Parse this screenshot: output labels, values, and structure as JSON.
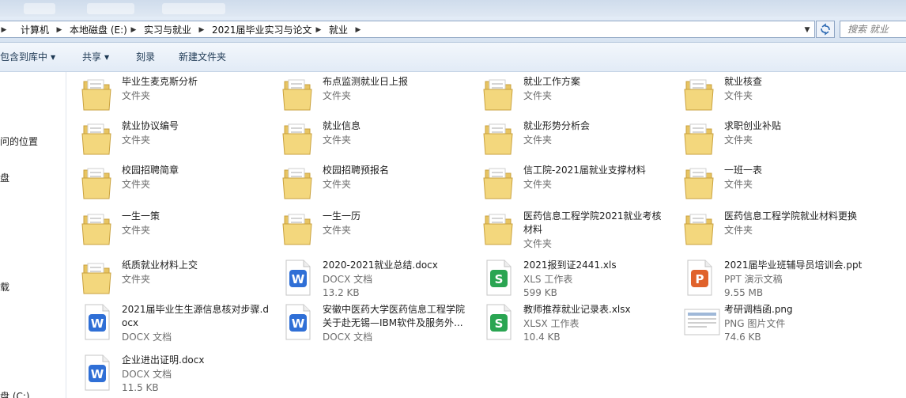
{
  "address": {
    "breadcrumbs": [
      "计算机",
      "本地磁盘 (E:)",
      "实习与就业",
      "2021届毕业实习与论文",
      "就业"
    ]
  },
  "search": {
    "placeholder": "搜索 就业"
  },
  "toolbar": {
    "include_label": "包含到库中",
    "share_label": "共享",
    "burn_label": "刻录",
    "new_folder_label": "新建文件夹"
  },
  "nav": {
    "items": [
      "问的位置",
      "盘",
      "载",
      "盘 (C:)"
    ]
  },
  "files": [
    {
      "name": "毕业生麦克斯分析",
      "type": "文件夹",
      "size": "",
      "icon": "folder-icon"
    },
    {
      "name": "布点监测就业日上报",
      "type": "文件夹",
      "size": "",
      "icon": "folder-icon"
    },
    {
      "name": "就业工作方案",
      "type": "文件夹",
      "size": "",
      "icon": "folder-icon"
    },
    {
      "name": "就业核查",
      "type": "文件夹",
      "size": "",
      "icon": "folder-icon"
    },
    {
      "name": "就业协议编号",
      "type": "文件夹",
      "size": "",
      "icon": "folder-icon"
    },
    {
      "name": "就业信息",
      "type": "文件夹",
      "size": "",
      "icon": "folder-icon"
    },
    {
      "name": "就业形势分析会",
      "type": "文件夹",
      "size": "",
      "icon": "folder-icon"
    },
    {
      "name": "求职创业补贴",
      "type": "文件夹",
      "size": "",
      "icon": "folder-icon"
    },
    {
      "name": "校园招聘简章",
      "type": "文件夹",
      "size": "",
      "icon": "folder-icon"
    },
    {
      "name": "校园招聘预报名",
      "type": "文件夹",
      "size": "",
      "icon": "folder-icon"
    },
    {
      "name": "信工院-2021届就业支撑材料",
      "type": "文件夹",
      "size": "",
      "icon": "folder-icon"
    },
    {
      "name": "一班一表",
      "type": "文件夹",
      "size": "",
      "icon": "folder-icon"
    },
    {
      "name": "一生一策",
      "type": "文件夹",
      "size": "",
      "icon": "folder-icon"
    },
    {
      "name": "一生一历",
      "type": "文件夹",
      "size": "",
      "icon": "folder-icon"
    },
    {
      "name": "医药信息工程学院2021就业考核材料",
      "type": "文件夹",
      "size": "",
      "icon": "folder-icon"
    },
    {
      "name": "医药信息工程学院就业材料更换",
      "type": "文件夹",
      "size": "",
      "icon": "folder-icon"
    },
    {
      "name": "纸质就业材料上交",
      "type": "文件夹",
      "size": "",
      "icon": "folder-icon"
    },
    {
      "name": "2020-2021就业总结.docx",
      "type": "DOCX 文档",
      "size": "13.2 KB",
      "icon": "word-doc-icon"
    },
    {
      "name": "2021报到证2441.xls",
      "type": "XLS 工作表",
      "size": "599 KB",
      "icon": "spreadsheet-icon"
    },
    {
      "name": "2021届毕业班辅导员培训会.ppt",
      "type": "PPT 演示文稿",
      "size": "9.55 MB",
      "icon": "presentation-icon"
    },
    {
      "name": "2021届毕业生生源信息核对步骤.docx",
      "type": "DOCX 文档",
      "size": "",
      "icon": "word-doc-icon"
    },
    {
      "name": "安徽中医药大学医药信息工程学院关于赴无锡—IBM软件及服务外...",
      "type": "DOCX 文档",
      "size": "",
      "icon": "word-doc-icon"
    },
    {
      "name": "教师推荐就业记录表.xlsx",
      "type": "XLSX 工作表",
      "size": "10.4 KB",
      "icon": "spreadsheet-icon"
    },
    {
      "name": "考研调档函.png",
      "type": "PNG 图片文件",
      "size": "74.6 KB",
      "icon": "image-icon"
    },
    {
      "name": "企业进出证明.docx",
      "type": "DOCX 文档",
      "size": "11.5 KB",
      "icon": "word-doc-icon"
    }
  ]
}
